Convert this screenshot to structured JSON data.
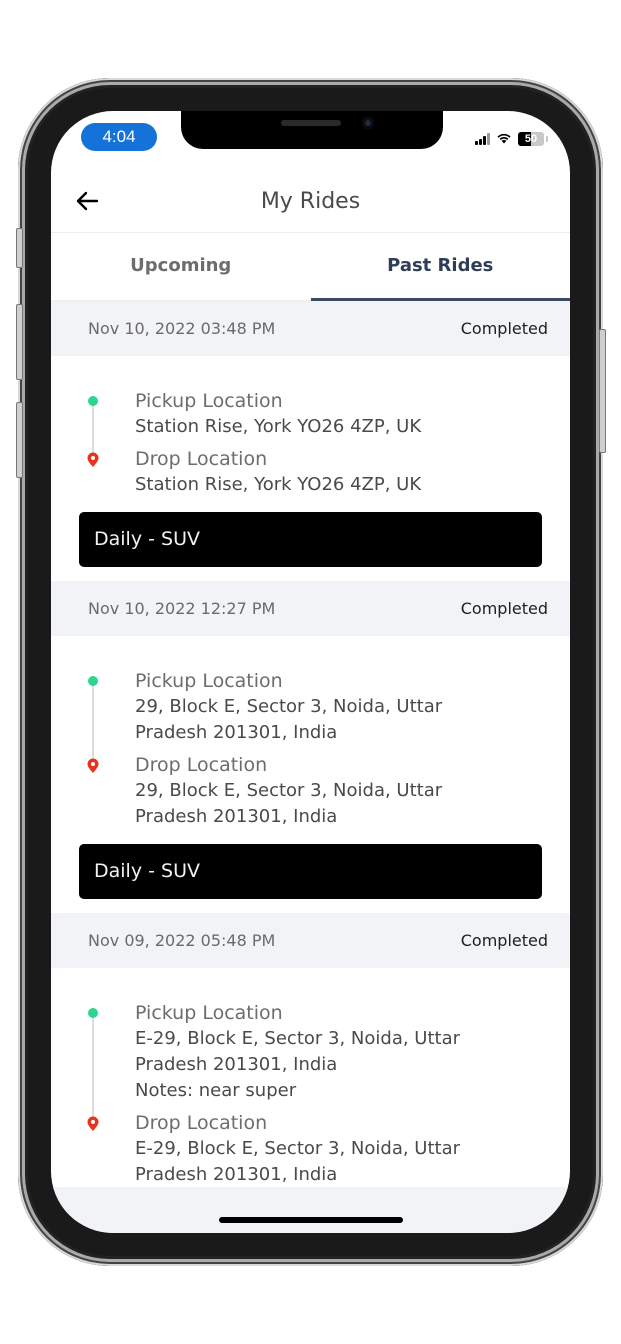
{
  "status_bar": {
    "time": "4:04",
    "battery_percent": 50,
    "battery_label": "50",
    "icons": [
      "cellular-signal-icon",
      "wifi-icon",
      "battery-icon"
    ]
  },
  "header": {
    "back_icon": "arrow-left-icon",
    "title": "My Rides"
  },
  "tabs": [
    {
      "label": "Upcoming",
      "active": false
    },
    {
      "label": "Past Rides",
      "active": true
    }
  ],
  "colors": {
    "accent": "#3c4a63",
    "time_pill": "#1572d8",
    "pickup_dot": "#2fd48e",
    "drop_pin": "#e8341c",
    "header_bg": "#f2f3f7"
  },
  "rides": [
    {
      "datetime": "Nov 10, 2022 03:48 PM",
      "status": "Completed",
      "pickup_label": "Pickup Location",
      "pickup_address": "Station Rise, York YO26 4ZP, UK",
      "drop_label": "Drop Location",
      "drop_address": "Station Rise, York YO26 4ZP, UK",
      "vehicle": "Daily - SUV"
    },
    {
      "datetime": "Nov 10, 2022 12:27 PM",
      "status": "Completed",
      "pickup_label": "Pickup Location",
      "pickup_address": "29, Block E, Sector 3, Noida, Uttar Pradesh 201301, India",
      "drop_label": "Drop Location",
      "drop_address": "29, Block E, Sector 3, Noida, Uttar Pradesh 201301, India",
      "vehicle": "Daily - SUV"
    },
    {
      "datetime": "Nov 09, 2022 05:48 PM",
      "status": "Completed",
      "pickup_label": "Pickup Location",
      "pickup_address": "E-29, Block E, Sector 3, Noida, Uttar Pradesh 201301, India",
      "pickup_notes": "Notes:  near super",
      "drop_label": "Drop Location",
      "drop_address": "E-29, Block E, Sector 3, Noida, Uttar Pradesh 201301, India"
    }
  ]
}
